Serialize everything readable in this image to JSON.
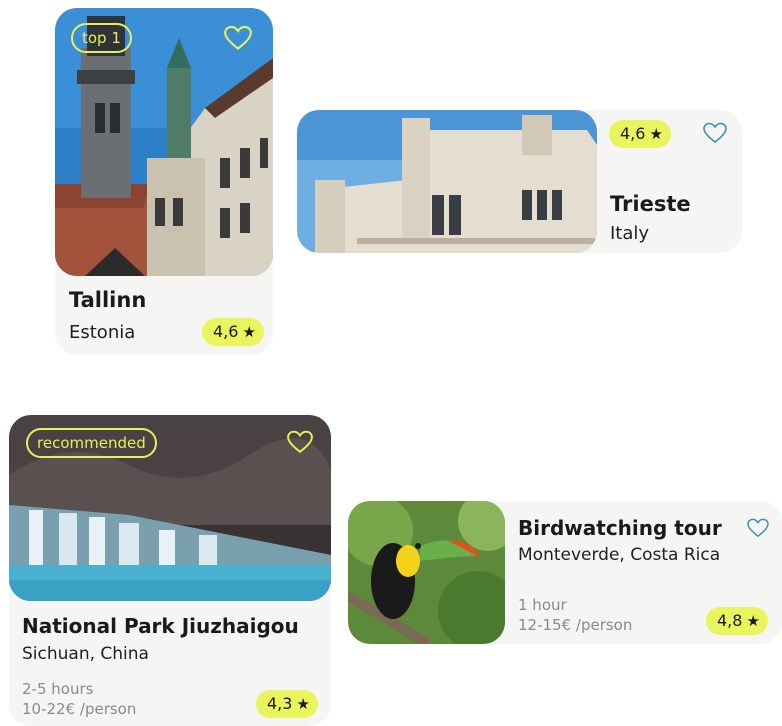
{
  "cards": [
    {
      "title": "Tallinn",
      "subtitle": "Estonia",
      "badge": "top 1",
      "rating": "4,6",
      "image_icon": "tallinn-town-hall-photo"
    },
    {
      "title": "Trieste",
      "subtitle": "Italy",
      "rating": "4,6",
      "image_icon": "trieste-castle-photo"
    },
    {
      "title": "National Park Jiuzhaigou",
      "subtitle": "Sichuan, China",
      "badge": "recommended",
      "duration": "2-5 hours",
      "price": "10-22€ /person",
      "rating": "4,3",
      "image_icon": "waterfall-forest-photo"
    },
    {
      "title": "Birdwatching tour",
      "subtitle": "Monteverde, Costa Rica",
      "duration": "1 hour",
      "price": "12-15€ /person",
      "rating": "4,8",
      "image_icon": "toucan-photo"
    }
  ],
  "star_glyph": "★",
  "colors": {
    "accent": "#eaf45c",
    "card_bg": "#f5f5f3",
    "heart": "#3a8fb0",
    "meta": "#8a8a8a"
  }
}
